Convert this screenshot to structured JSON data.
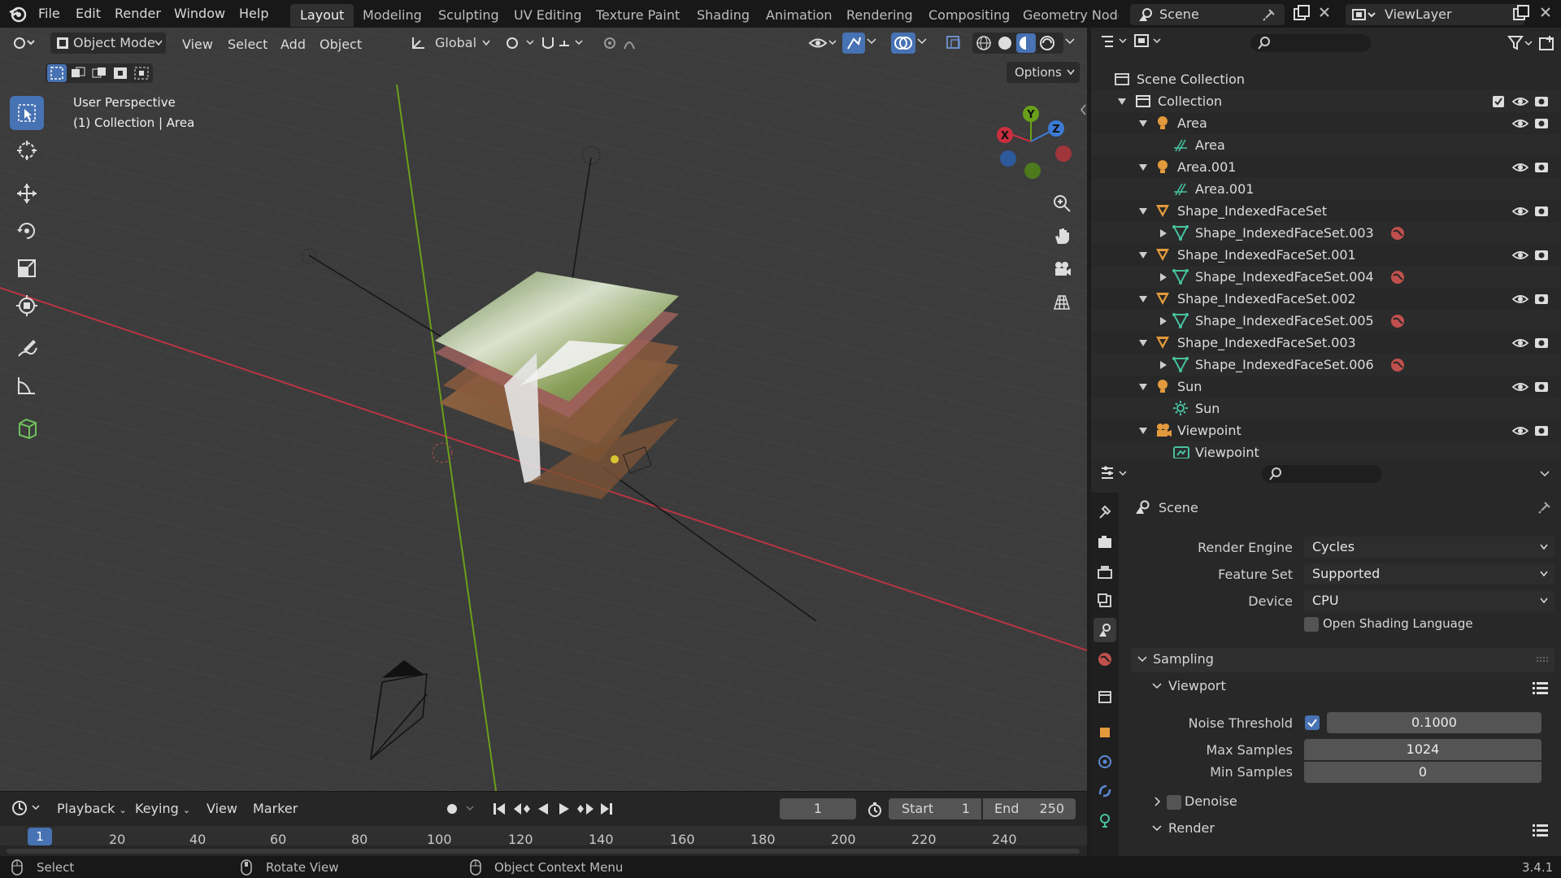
{
  "topbar": {
    "menus": [
      "File",
      "Edit",
      "Render",
      "Window",
      "Help"
    ],
    "workspaces": [
      "Layout",
      "Modeling",
      "Sculpting",
      "UV Editing",
      "Texture Paint",
      "Shading",
      "Animation",
      "Rendering",
      "Compositing",
      "Geometry Node:"
    ],
    "active_workspace": "Layout",
    "scene": "Scene",
    "view_layer": "ViewLayer"
  },
  "viewport_header": {
    "mode": "Object Mode",
    "menus": [
      "View",
      "Select",
      "Add",
      "Object"
    ],
    "transform_orientation": "Global",
    "options": "Options"
  },
  "viewport": {
    "perspective": "User Perspective",
    "collection": "(1) Collection | Area",
    "gizmo": {
      "x": "X",
      "y": "Y",
      "z": "Z"
    }
  },
  "timeline": {
    "menus": [
      "Playback",
      "Keying",
      "View",
      "Marker"
    ],
    "current_frame": "1",
    "start_label": "Start",
    "start": "1",
    "end_label": "End",
    "end": "250",
    "ruler": [
      "1",
      "20",
      "40",
      "60",
      "80",
      "100",
      "120",
      "140",
      "160",
      "180",
      "200",
      "220",
      "240"
    ]
  },
  "statusbar": {
    "select": "Select",
    "rotate": "Rotate View",
    "context": "Object Context Menu",
    "version": "3.4.1"
  },
  "outliner": {
    "root": "Scene Collection",
    "collection": "Collection",
    "items": [
      {
        "name": "Area",
        "child": "Area",
        "type": "light"
      },
      {
        "name": "Area.001",
        "child": "Area.001",
        "type": "light"
      },
      {
        "name": "Shape_IndexedFaceSet",
        "child": "Shape_IndexedFaceSet.003",
        "type": "mesh"
      },
      {
        "name": "Shape_IndexedFaceSet.001",
        "child": "Shape_IndexedFaceSet.004",
        "type": "mesh"
      },
      {
        "name": "Shape_IndexedFaceSet.002",
        "child": "Shape_IndexedFaceSet.005",
        "type": "mesh"
      },
      {
        "name": "Shape_IndexedFaceSet.003",
        "child": "Shape_IndexedFaceSet.006",
        "type": "mesh"
      },
      {
        "name": "Sun",
        "child": "Sun",
        "type": "sun"
      },
      {
        "name": "Viewpoint",
        "child": "Viewpoint",
        "type": "camera"
      }
    ]
  },
  "properties": {
    "context": "Scene",
    "render_engine_label": "Render Engine",
    "render_engine": "Cycles",
    "feature_set_label": "Feature Set",
    "feature_set": "Supported",
    "device_label": "Device",
    "device": "CPU",
    "osl_label": "Open Shading Language",
    "sampling": "Sampling",
    "viewport_panel": "Viewport",
    "noise_threshold_label": "Noise Threshold",
    "noise_threshold": "0.1000",
    "max_samples_label": "Max Samples",
    "max_samples": "1024",
    "min_samples_label": "Min Samples",
    "min_samples": "0",
    "denoise_label": "Denoise",
    "render_panel": "Render"
  },
  "colors": {
    "accent": "#4772b3",
    "x_axis": "#c8303f",
    "y_axis": "#6aa01a",
    "light_icon": "#e39a3c",
    "mesh_icon": "#e39a3c",
    "data_icon": "#47c19e"
  }
}
